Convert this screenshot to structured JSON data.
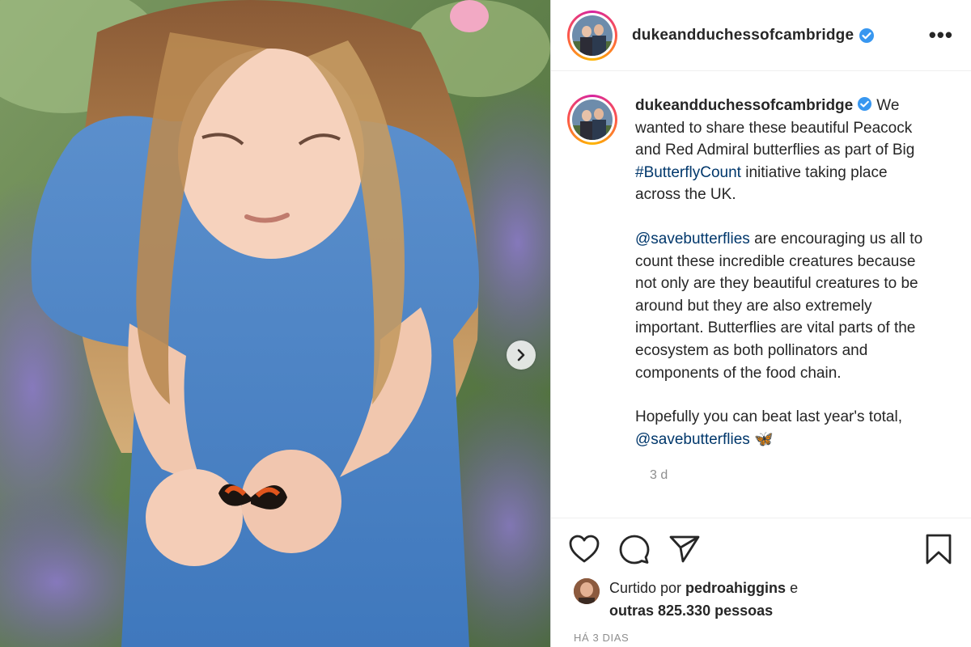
{
  "post": {
    "username": "dukeandduchessofcambridge",
    "verified": true,
    "more_label": "•••",
    "photo": {
      "next_icon": "chevron-right-icon"
    },
    "caption": {
      "username": "dukeandduchessofcambridge",
      "p1_start": "We wanted to share these beautiful Peacock and Red Admiral butterflies as part of Big ",
      "p1_hashtag": "#ButterflyCount",
      "p1_end": " initiative taking place across the UK.",
      "p2_mention": "@savebutterflies",
      "p2_text": " are encouraging us all to count these incredible creatures because not only are they beautiful creatures to be around but they are also extremely important. Butterflies are vital parts of the ecosystem as both pollinators and components of the food chain.",
      "p3_text": "Hopefully you can beat last year's total, ",
      "p3_mention": "@savebutterflies",
      "p3_emoji": "🦋",
      "time": "3 d"
    },
    "actions": {
      "like_icon": "heart-icon",
      "comment_icon": "comment-icon",
      "share_icon": "paper-plane-icon",
      "save_icon": "bookmark-icon"
    },
    "likes": {
      "prefix": "Curtido por ",
      "liker": "pedroahiggins",
      "mid": " e",
      "others": "outras 825.330 pessoas"
    },
    "posted_ago": "HÁ 3 DIAS"
  },
  "colors": {
    "link": "#00376b",
    "verified": "#3897f0",
    "muted": "#8e8e8e",
    "border": "#dbdbdb"
  }
}
